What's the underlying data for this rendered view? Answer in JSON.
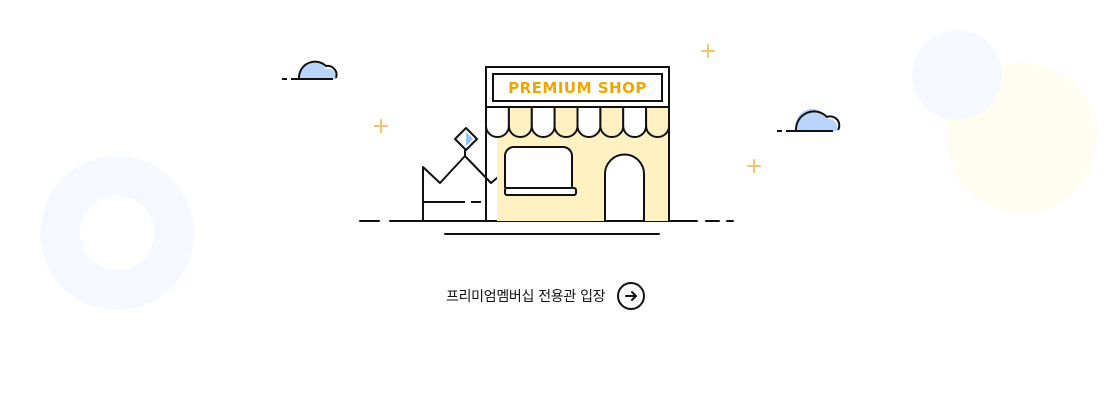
{
  "illustration": {
    "sign_text": "PREMIUM SHOP",
    "icon": "storefront-icon"
  },
  "cta": {
    "label": "프리미엄멤버십 전용관 입장",
    "icon": "arrow-right-circle-icon"
  },
  "colors": {
    "sign_text": "#f0a500",
    "shop_fill": "#fff1c2",
    "sparkle": "#f6c26a",
    "cloud": "#b9d5fb",
    "bg_ring_blue": "#f5f9ff",
    "bg_circle_yellow": "#fffdf0",
    "outline": "#111111"
  }
}
